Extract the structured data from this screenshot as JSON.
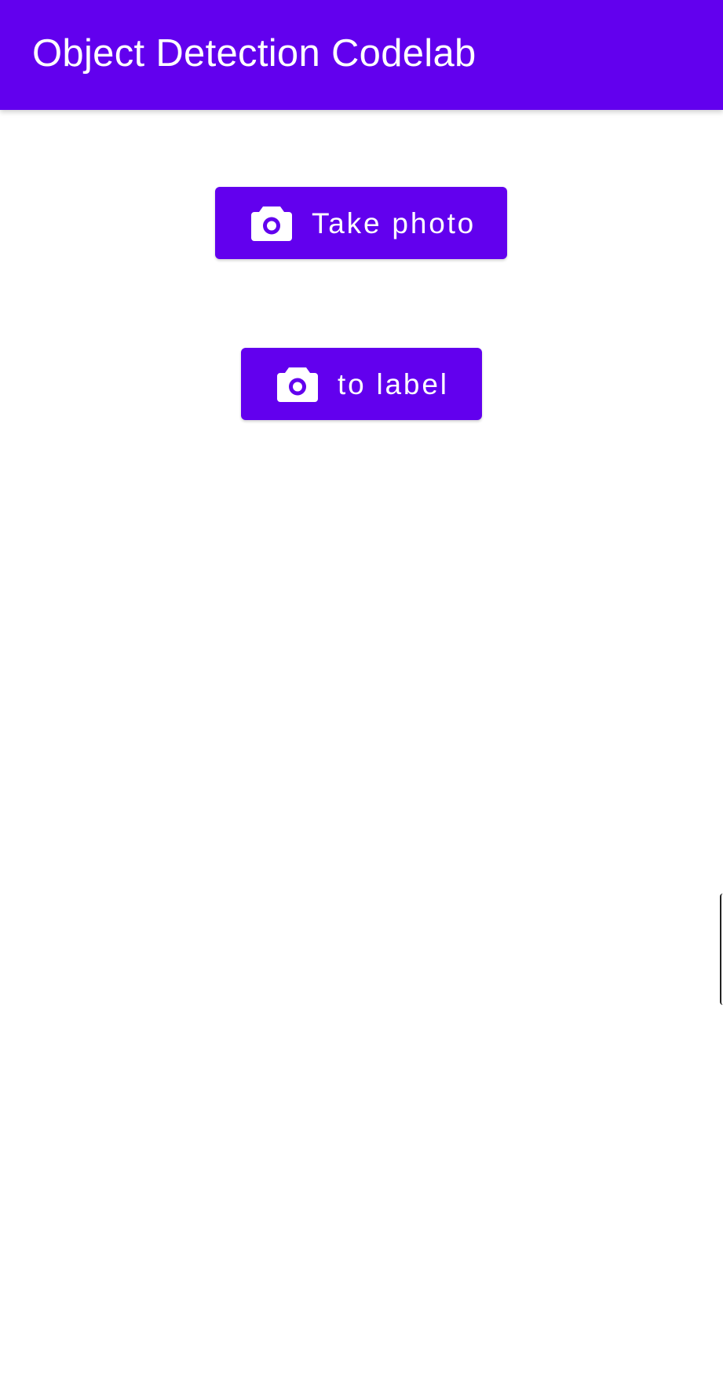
{
  "app_bar": {
    "title": "Object Detection Codelab",
    "color": "#6200ee"
  },
  "actions": {
    "take_photo": {
      "label": "Take photo",
      "icon": "camera-icon"
    },
    "to_label": {
      "label": "to label",
      "icon": "camera-icon"
    }
  },
  "colors": {
    "primary": "#6200ee",
    "on_primary": "#ffffff",
    "background": "#ffffff"
  }
}
